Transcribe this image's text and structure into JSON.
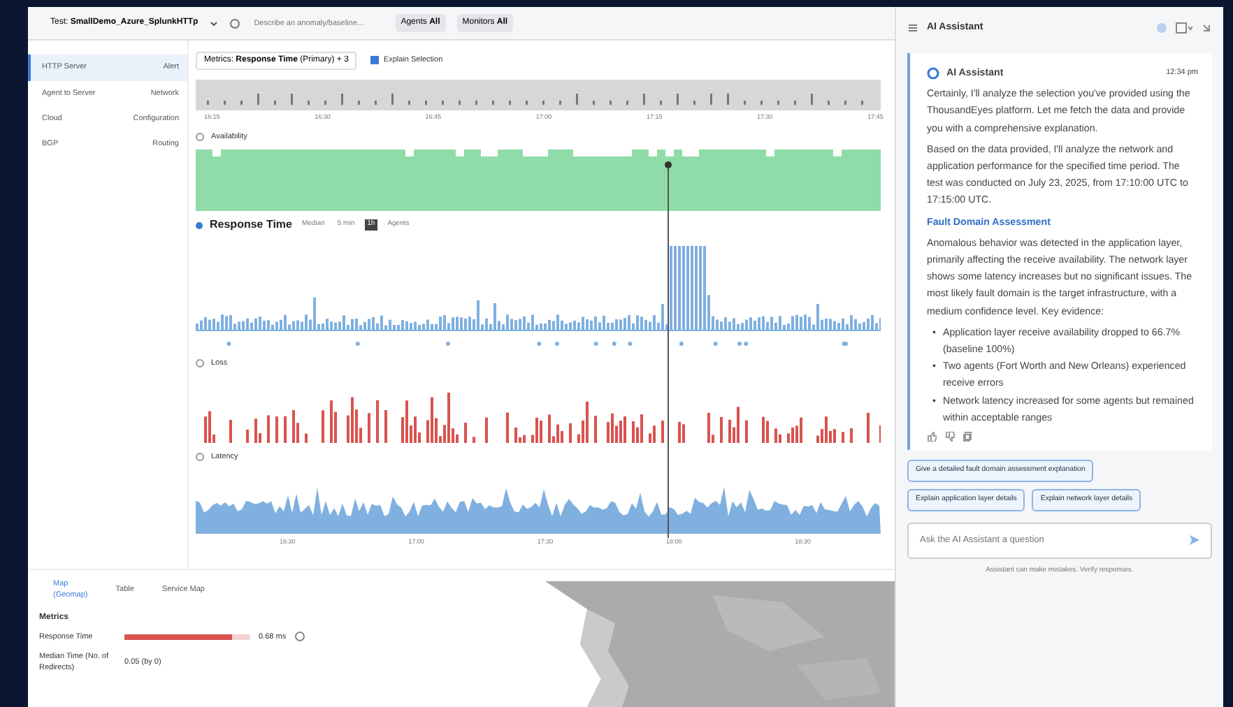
{
  "test_bar": {
    "label": "Test:",
    "test_name": "SmallDemo_Azure_SplunkHTTp",
    "search_placeholder": "Describe an anomaly/baseline...",
    "filters": [
      {
        "label": "Agents",
        "value": "All"
      },
      {
        "label": "Monitors",
        "value": "All"
      }
    ]
  },
  "sidebar": {
    "items": [
      {
        "name": "HTTP Server",
        "tag": "Alert",
        "selected": true
      },
      {
        "name": "Agent to Server",
        "tag": "Network",
        "selected": false
      },
      {
        "name": "Cloud",
        "tag": "Configuration",
        "selected": false
      },
      {
        "name": "BGP",
        "tag": "Routing",
        "selected": false
      }
    ]
  },
  "metrics_selector": {
    "label": "Metrics:",
    "value": "Response Time",
    "suffix": "(Primary) + 3"
  },
  "explain_selection": {
    "label": "Explain Selection",
    "checked": true
  },
  "timeline": {
    "ticks": [
      "16:15",
      "16:30",
      "16:45",
      "17:00",
      "17:15",
      "17:30",
      "17:45"
    ]
  },
  "panels": [
    {
      "kind": "band",
      "title": "Availability",
      "primary": false,
      "color": "#8fdca8"
    },
    {
      "kind": "bars",
      "title": "Response Time",
      "primary": true,
      "color": "#7fb0e0",
      "options": [
        {
          "label": "Median",
          "selected": false
        },
        {
          "label": "5 min",
          "selected": false
        },
        {
          "label": "1h",
          "selected": true
        },
        {
          "label": "Agents",
          "selected": false
        }
      ]
    },
    {
      "kind": "bars",
      "title": "Loss",
      "primary": false,
      "color": "#d9534f"
    },
    {
      "kind": "area",
      "title": "Latency",
      "primary": false,
      "color": "#7fb0e0"
    }
  ],
  "x_ticks": [
    "16:30",
    "17:00",
    "17:30",
    "18:00",
    "18:30"
  ],
  "bottom_tabs": [
    {
      "label": "Map",
      "sublabel": "(Geomap)",
      "selected": true
    },
    {
      "label": "Table",
      "selected": false
    },
    {
      "label": "Service Map",
      "selected": false
    }
  ],
  "metrics": {
    "title": "Metrics",
    "rows": [
      {
        "kind": "bar",
        "label": "Response Time",
        "level": 0.85,
        "value": "0.68 ms"
      },
      {
        "kind": "text",
        "label": "Median Time (No. of Redirects)",
        "value": "0.05 (by 0)"
      }
    ]
  },
  "assistant": {
    "title": "AI Assistant",
    "message": {
      "author": "AI Assistant",
      "time": "12:34 pm",
      "paragraphs": [
        "Certainly, I'll analyze the selection you've provided using the ThousandEyes platform. Let me fetch the data and provide you with a comprehensive explanation.",
        "Based on the data provided, I'll analyze the network and application performance for the specified time period. The test was conducted on July 23, 2025, from 17:10:00 UTC to 17:15:00 UTC."
      ],
      "heading": "Fault Domain Assessment",
      "body": "Anomalous behavior was detected in the application layer, primarily affecting the receive availability. The network layer shows some latency increases but no significant issues. The most likely fault domain is the target infrastructure, with a medium confidence level. Key evidence:",
      "bullets": [
        {
          "marker": "•",
          "text": "Application layer receive availability dropped to 66.7% (baseline 100%)"
        },
        {
          "marker": "•",
          "text": "Two agents (Fort Worth and New Orleans) experienced receive errors"
        },
        {
          "marker": "•",
          "text": "Network latency increased for some agents but remained within acceptable ranges"
        }
      ]
    },
    "suggestions": [
      "Give a detailed fault domain assessment explanation",
      "Explain application layer details",
      "Explain network layer details"
    ],
    "input_placeholder": "Ask the AI Assistant a question",
    "disclaimer": "Assistant can make mistakes. Verify responses."
  }
}
